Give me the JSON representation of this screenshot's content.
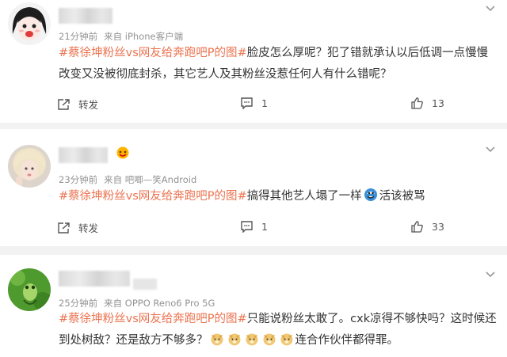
{
  "comments": [
    {
      "meta": {
        "time": "21分钟前",
        "source": "来自 iPhone客户端"
      },
      "topic": "#蔡徐坤粉丝vs网友给奔跑吧P的图#",
      "text": "脸皮怎么厚呢？犯了错就承认以后低调一点慢慢改变又没被彻底封杀，其它艺人及其粉丝没惹任何人有什么错呢？",
      "repost_label": "转发",
      "comment_count": "1",
      "like_count": "13"
    },
    {
      "meta": {
        "time": "23分钟前",
        "source": "来自 吧唧—笑Android"
      },
      "topic": "#蔡徐坤粉丝vs网友给奔跑吧P的图#",
      "text": "搞得其他艺人塌了一样",
      "text_after": "活该被骂",
      "repost_label": "转发",
      "comment_count": "1",
      "like_count": "33"
    },
    {
      "meta": {
        "time": "25分钟前",
        "source": "来自 OPPO Reno6 Pro 5G"
      },
      "topic": "#蔡徐坤粉丝vs网友给奔跑吧P的图#",
      "text": "只能说粉丝太敢了。cxk凉得不够快吗？这时候还到处树敌？还是敌方不够多？",
      "text_after": "连合作伙伴都得罪。"
    }
  ],
  "colors": {
    "topic": "#eb7350",
    "meta": "#939393",
    "divider": "#f2f2f2"
  },
  "icons": [
    "repost-icon",
    "comment-icon",
    "like-icon",
    "chevron-down-icon",
    "doge-emoji",
    "troll-emoji",
    "vip-badge-icon"
  ]
}
